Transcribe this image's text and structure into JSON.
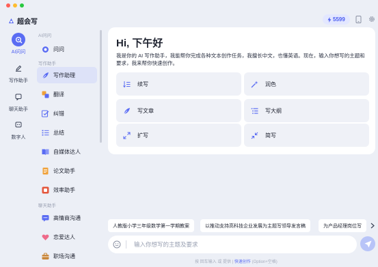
{
  "colors": {
    "accent": "#5a6cf3",
    "window_bg": "#eceff6",
    "card_bg": "#eff1f7",
    "red": "#ff5f57",
    "yellow": "#febc2e",
    "green": "#28c840"
  },
  "app": {
    "name": "超会写",
    "credits": "5599"
  },
  "rail": [
    {
      "label": "AI问问",
      "icon": "ai-chat-icon",
      "active": true
    },
    {
      "label": "写作助手",
      "icon": "pen-icon",
      "active": false
    },
    {
      "label": "聊天助手",
      "icon": "chat-bubble-icon",
      "active": false
    },
    {
      "label": "数字人",
      "icon": "digital-human-icon",
      "active": false
    }
  ],
  "sidebar": {
    "section_ai": "AI问问",
    "section_writing": "写作助手",
    "section_chat": "聊天助手",
    "items": [
      {
        "label": "问问",
        "icon": "ask-icon"
      },
      {
        "label": "写作助理",
        "icon": "feather-icon",
        "active": true
      },
      {
        "label": "翻译",
        "icon": "translate-icon"
      },
      {
        "label": "纠错",
        "icon": "correction-icon"
      },
      {
        "label": "总结",
        "icon": "list-icon"
      },
      {
        "label": "自媒体达人",
        "icon": "book-icon"
      },
      {
        "label": "论文助手",
        "icon": "paper-icon"
      },
      {
        "label": "效率助手",
        "icon": "efficiency-icon"
      },
      {
        "label": "高情商沟通",
        "icon": "message-icon"
      },
      {
        "label": "恋爱达人",
        "icon": "heart-icon"
      },
      {
        "label": "职场沟通",
        "icon": "briefcase-icon"
      }
    ]
  },
  "main": {
    "greeting": "Hi, 下午好",
    "intro": "我是你的 AI 写作助手，我能帮你完成各种文本创作任务，我擅长中文，也懂英语。现在，输入你想写的主题和要求，我来帮你快速创作。",
    "cards": [
      {
        "label": "续写",
        "icon": "continue-icon"
      },
      {
        "label": "润色",
        "icon": "polish-icon"
      },
      {
        "label": "写文章",
        "icon": "article-icon"
      },
      {
        "label": "写大纲",
        "icon": "outline-icon"
      },
      {
        "label": "扩写",
        "icon": "expand-icon"
      },
      {
        "label": "简写",
        "icon": "shrink-icon"
      }
    ]
  },
  "suggestions": [
    "人教版小学三年级数学第一学期教案",
    "以推动支持高科技企业发展为主题写领导发言稿",
    "为产品经理岗位写"
  ],
  "input": {
    "placeholder": "输入你想写的主题及要求"
  },
  "footer": {
    "hint_prefix": "按 回车输入 或 提供 |",
    "hint_accent": "快速创作",
    "hint_suffix": "(Option+空格)"
  }
}
